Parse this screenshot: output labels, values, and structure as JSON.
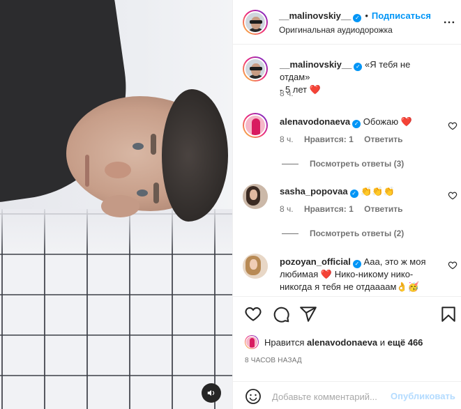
{
  "colors": {
    "accent": "#0095f6",
    "heart": "#ed4956",
    "muted": "#737373",
    "text": "#262626"
  },
  "header": {
    "username": "__malinovskiy__",
    "separator": "•",
    "subscribe_label": "Подписаться",
    "audio_label": "Оригинальная аудиодорожка",
    "more_icon": "more-dots-icon"
  },
  "caption": {
    "username": "__malinovskiy__",
    "text_line1": "«Я тебя не отдам»",
    "text_line2": "- 5 лет",
    "emoji": "❤️",
    "time": "8 ч."
  },
  "comments": [
    {
      "username": "alenavodonaeva",
      "text": "Обожаю",
      "emoji": "❤️",
      "time": "8 ч.",
      "likes": "Нравится: 1",
      "reply": "Ответить",
      "view_replies": "Посмотреть ответы (3)"
    },
    {
      "username": "sasha_popovaa",
      "text": "",
      "emoji": "👏👏👏",
      "time": "8 ч.",
      "likes": "Нравится: 1",
      "reply": "Ответить",
      "view_replies": "Посмотреть ответы (2)"
    },
    {
      "username": "pozoyan_official",
      "text_line1": "Ааа, это ж моя",
      "text_line2": "любимая",
      "text_line2_emoji": "❤️",
      "text_line2_tail": "Нико-никому нико-",
      "text_line3": "никогда я тебя не отдаааам",
      "text_line3_emoji": "👌🥳"
    }
  ],
  "actions": {
    "like_icon": "heart-icon",
    "comment_icon": "comment-icon",
    "share_icon": "share-icon",
    "save_icon": "bookmark-icon"
  },
  "likes": {
    "prefix": "Нравится",
    "user": "alenavodonaeva",
    "middle": "и",
    "rest": "ещё 466"
  },
  "time_ago": "8 ЧАСОВ НАЗАД",
  "add_comment": {
    "placeholder": "Добавьте комментарий...",
    "publish_label": "Опубликовать",
    "emoji_icon": "smiley-icon"
  },
  "media": {
    "sound_icon": "speaker-icon"
  }
}
